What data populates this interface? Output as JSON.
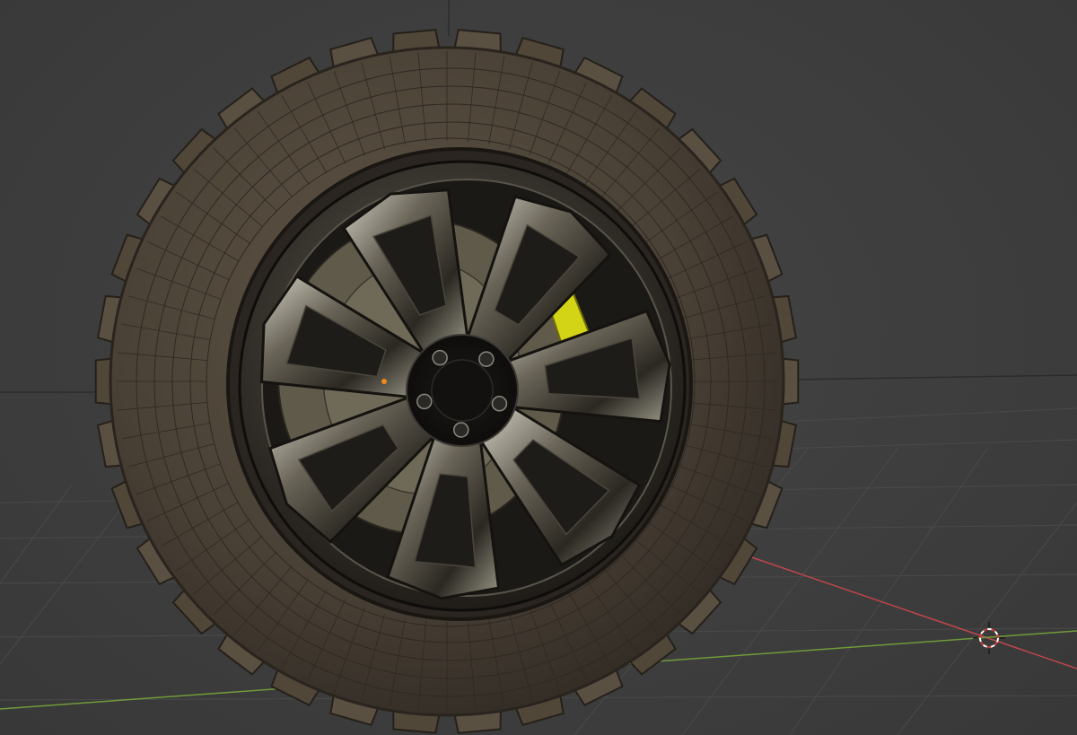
{
  "viewport": {
    "background_color": "#3d3d3d",
    "grid_color": "#4a4a4a",
    "x_axis_color": "#c0464b",
    "y_axis_color": "#6f9b3a",
    "cursor_colors": [
      "#d33b3b",
      "#ffffff"
    ]
  },
  "scene": {
    "object": "wheel",
    "tire_color": "#4a4136",
    "rim_color": "#3a3630",
    "rim_highlight_color": "#8c8c84",
    "brake_caliper_color": "#d4d416",
    "origin_dot_color": "#f08a1e",
    "spokes": 7,
    "lug_nuts": 5
  },
  "icons": {
    "cursor": "3d-cursor-icon",
    "origin": "object-origin-icon"
  }
}
